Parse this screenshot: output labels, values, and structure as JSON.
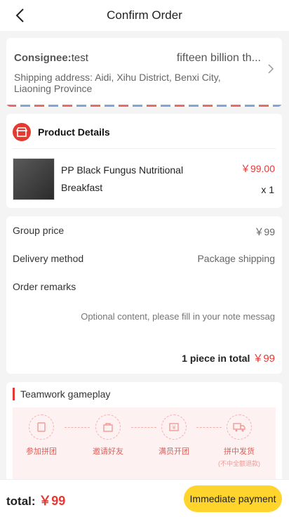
{
  "header": {
    "title": "Confirm Order"
  },
  "address": {
    "consignee_label": "Consignee:",
    "consignee_name": "test",
    "phone": "fifteen billion th...",
    "shipping": "Shipping address: Aidi, Xihu District, Benxi City, Liaoning Province"
  },
  "product": {
    "section_title": "Product Details",
    "name": "PP Black Fungus Nutritional Breakfast",
    "price": "￥99.00",
    "quantity": "x 1"
  },
  "details": {
    "group_price_label": "Group price",
    "group_price_value": "￥99",
    "delivery_label": "Delivery method",
    "delivery_value": "Package shipping",
    "remarks_label": "Order remarks",
    "remarks_placeholder": "Optional content, please fill in your note messag",
    "total_prefix": "1 piece in total",
    "total_amount": "￥99"
  },
  "teamwork": {
    "title": "Teamwork gameplay",
    "steps": [
      {
        "label": "参加拼团",
        "icon": "join-group-icon"
      },
      {
        "label": "邀请好友",
        "icon": "invite-friends-icon"
      },
      {
        "label": "满员开团",
        "icon": "group-full-icon"
      },
      {
        "label": "拼中发货",
        "sub": "(不中全额退款)",
        "icon": "shipping-truck-icon"
      }
    ]
  },
  "footer": {
    "total_label": "total:",
    "total_amount": "￥99",
    "pay_label": "Immediate payment"
  },
  "colors": {
    "accent_red": "#e53935",
    "pay_button": "#ffd42c"
  }
}
